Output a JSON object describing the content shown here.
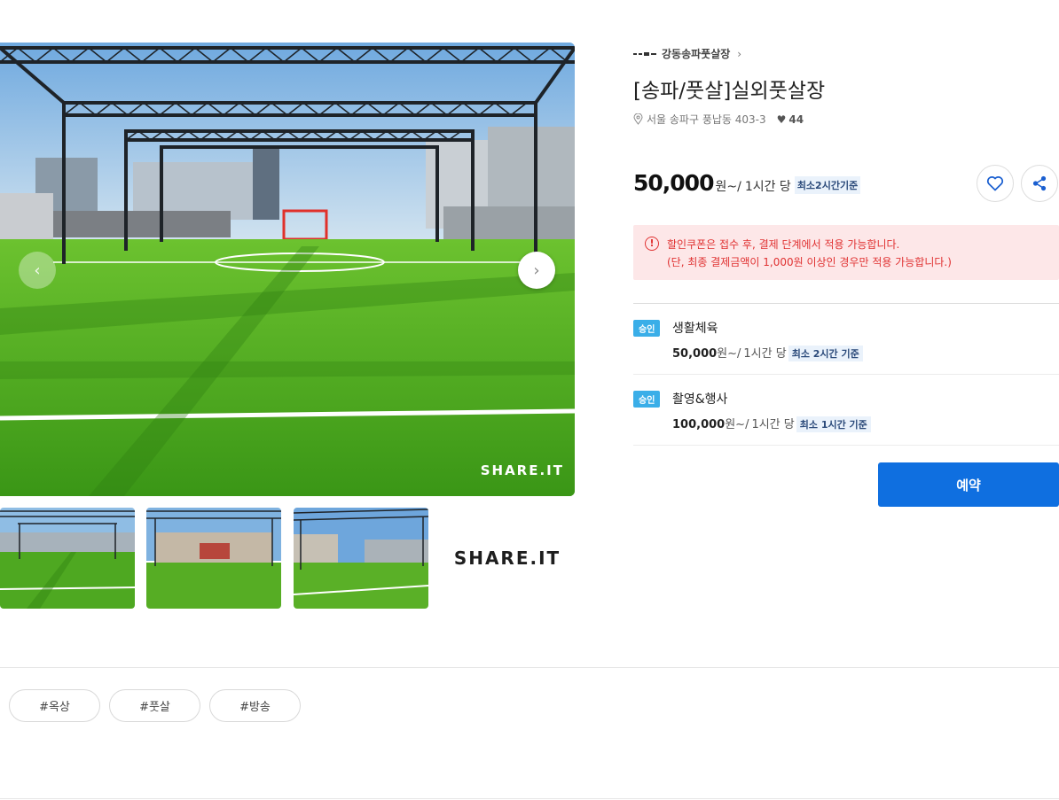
{
  "gallery": {
    "watermark": "SHARE.IT",
    "prev_icon": "chevron-left-icon",
    "next_icon": "chevron-right-icon",
    "thumb_logo_text": "SHARE.IT"
  },
  "host": {
    "name": "강동송파풋살장",
    "chevron": "›"
  },
  "space": {
    "title": "[송파/풋살]실외풋살장",
    "address": "서울 송파구 풍납동 403-3",
    "like_count": "44"
  },
  "price": {
    "amount": "50,000",
    "unit": "원~/",
    "per": "1시간 당",
    "min_badge": "최소2시간기준"
  },
  "actions": {
    "like_icon": "heart-outline-icon",
    "share_icon": "share-icon"
  },
  "notice": {
    "icon": "!",
    "line1": "할인쿠폰은 접수 후, 결제 단계에서 적용 가능합니다.",
    "line2": "(단, 최종 결제금액이 1,000원 이상인 경우만 적용 가능합니다.)"
  },
  "plans": [
    {
      "badge": "승인",
      "name": "생활체육",
      "price": "50,000",
      "unit": "원~/",
      "per": "1시간 당",
      "min": "최소 2시간 기준"
    },
    {
      "badge": "승인",
      "name": "촬영&행사",
      "price": "100,000",
      "unit": "원~/",
      "per": "1시간 당",
      "min": "최소 1시간 기준"
    }
  ],
  "reserve_label": "예약",
  "tags": [
    "#옥상",
    "#풋살",
    "#방송"
  ],
  "colors": {
    "accent": "#0f6fe0",
    "badge": "#3aaee8",
    "notice_bg": "#fde7e8",
    "notice_text": "#e03232"
  }
}
